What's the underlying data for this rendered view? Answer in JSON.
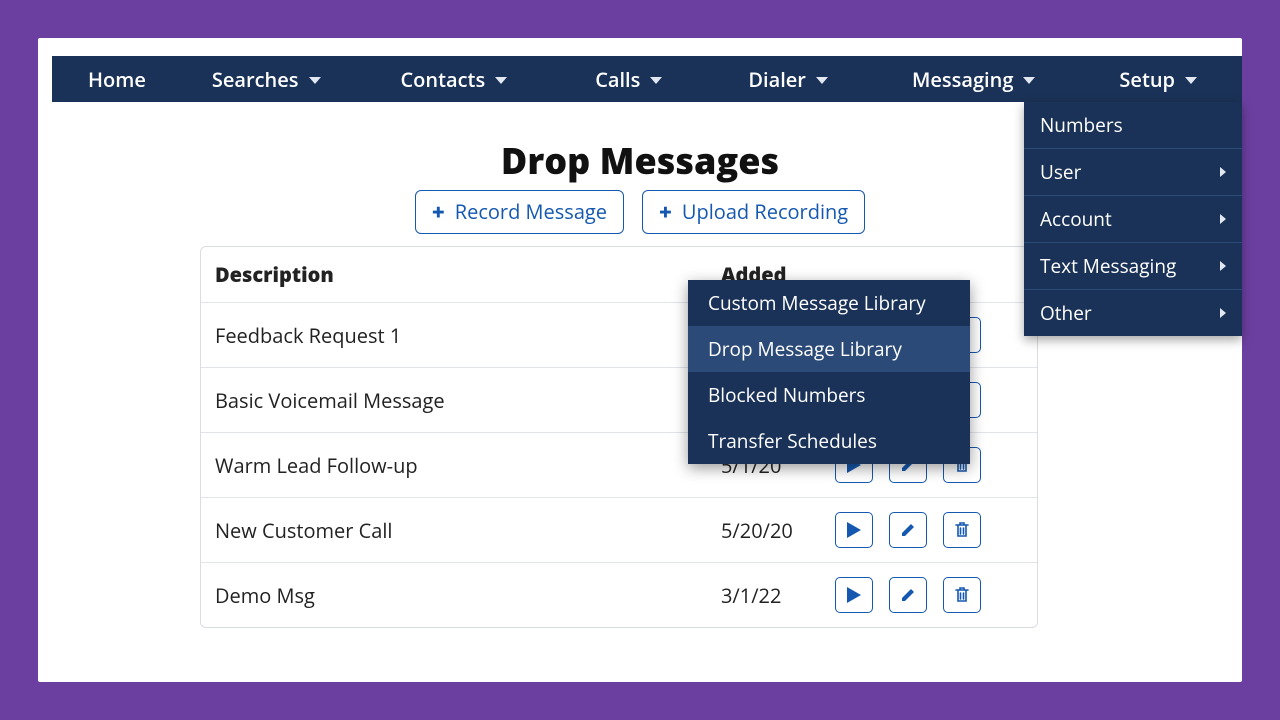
{
  "nav": {
    "home": "Home",
    "searches": "Searches",
    "contacts": "Contacts",
    "calls": "Calls",
    "dialer": "Dialer",
    "messaging": "Messaging",
    "setup": "Setup"
  },
  "page_title": "Drop Messages",
  "actions": {
    "record": "Record Message",
    "upload": "Upload Recording"
  },
  "table": {
    "headers": {
      "description": "Description",
      "added": "Added"
    },
    "rows": [
      {
        "description": "Feedback Request 1",
        "added": ""
      },
      {
        "description": "Basic Voicemail Message",
        "added": ""
      },
      {
        "description": "Warm Lead Follow-up",
        "added": "5/1/20"
      },
      {
        "description": "New Customer Call",
        "added": "5/20/20"
      },
      {
        "description": "Demo Msg",
        "added": "3/1/22"
      }
    ]
  },
  "setup_menu": {
    "numbers": "Numbers",
    "user": "User",
    "account": "Account",
    "text_messaging": "Text Messaging",
    "other": "Other"
  },
  "other_submenu": {
    "custom_library": "Custom Message Library",
    "drop_library": "Drop Message Library",
    "blocked_numbers": "Blocked Numbers",
    "transfer_schedules": "Transfer Schedules"
  },
  "colors": {
    "navy": "#1a3257",
    "navy_hover": "#2b4a77",
    "primary": "#1558b0",
    "purple_bg": "#6b3fa0"
  }
}
